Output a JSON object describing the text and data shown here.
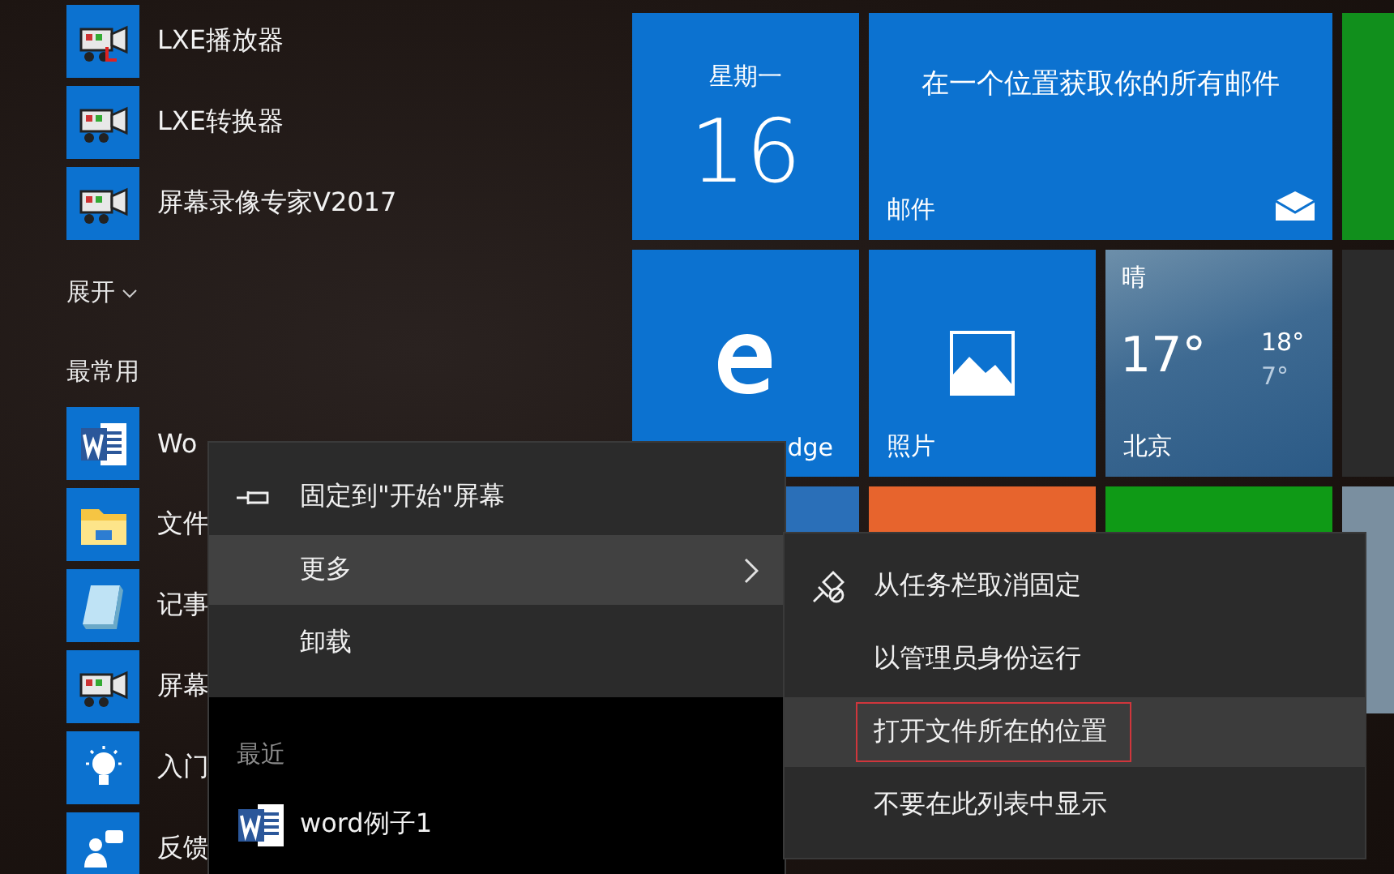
{
  "app_list": {
    "top_apps": [
      {
        "name": "LXE播放器",
        "kind": "camera-red"
      },
      {
        "name": "LXE转换器",
        "kind": "camera"
      },
      {
        "name": "屏幕录像专家V2017",
        "kind": "camera"
      }
    ],
    "expand_label": "展开",
    "section_title": "最常用",
    "frequent_apps": [
      {
        "name": "Wo",
        "kind": "word"
      },
      {
        "name": "文件",
        "kind": "folder"
      },
      {
        "name": "记事",
        "kind": "notepad"
      },
      {
        "name": "屏幕",
        "kind": "camera"
      },
      {
        "name": "入门",
        "kind": "bulb"
      },
      {
        "name": "反馈",
        "kind": "people"
      }
    ]
  },
  "tiles": [
    {
      "kind": "calendar",
      "weekday": "星期一",
      "day": "16"
    },
    {
      "kind": "mail",
      "message": "在一个位置获取你的所有邮件",
      "label": "邮件"
    },
    {
      "kind": "plain",
      "color": "#118f1c"
    },
    {
      "kind": "edge",
      "label": "dge"
    },
    {
      "kind": "photos",
      "label": "照片"
    },
    {
      "kind": "weather",
      "condition": "晴",
      "temp": "17°",
      "high": "18°",
      "low": "7°",
      "city": "北京"
    },
    {
      "kind": "plain",
      "color": "#2b2b2b"
    },
    {
      "kind": "plain",
      "color": "#2a6fb8"
    },
    {
      "kind": "plain",
      "color": "#e7642d"
    },
    {
      "kind": "plain",
      "color": "#0f9a16"
    },
    {
      "kind": "plain",
      "color": "#7a8fa0"
    }
  ],
  "context_menu": {
    "items": [
      {
        "label": "固定到\"开始\"屏幕",
        "kind": "pin",
        "has_submenu": false,
        "selected": false
      },
      {
        "label": "更多",
        "kind": "plain",
        "has_submenu": true,
        "selected": true
      },
      {
        "label": "卸载",
        "kind": "plain",
        "has_submenu": false,
        "selected": false
      }
    ],
    "recent_title": "最近",
    "recent_items": [
      {
        "label": "word例子1"
      }
    ]
  },
  "submenu": {
    "items": [
      {
        "label": "从任务栏取消固定",
        "kind": "unpin",
        "selected": false,
        "outlined": false
      },
      {
        "label": "以管理员身份运行",
        "kind": "plain",
        "selected": false,
        "outlined": false
      },
      {
        "label": "打开文件所在的位置",
        "kind": "plain",
        "selected": true,
        "outlined": true
      },
      {
        "label": "不要在此列表中显示",
        "kind": "plain",
        "selected": false,
        "outlined": false
      }
    ]
  }
}
